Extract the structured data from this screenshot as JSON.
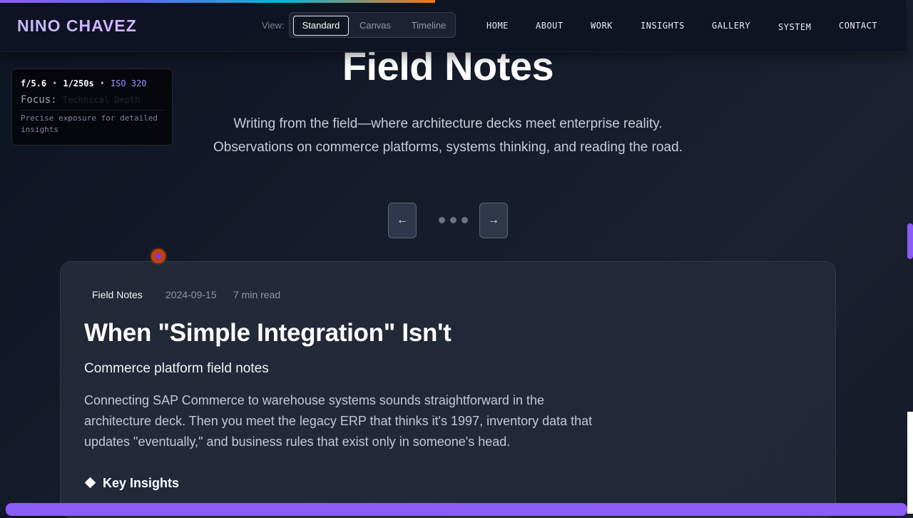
{
  "brand": {
    "logo": "NINO CHAVEZ"
  },
  "view": {
    "label": "View:",
    "options": [
      "Standard",
      "Canvas",
      "Timeline"
    ],
    "selected": "Standard"
  },
  "nav": {
    "items": [
      "HOME",
      "ABOUT",
      "WORK",
      "INSIGHTS",
      "GALLERY",
      "SYSTEM",
      "CONTACT"
    ]
  },
  "exposure": {
    "aperture": "f/5.6",
    "sep": "•",
    "shutter": "1/250s",
    "iso": "ISO 320",
    "focus_label": "Focus:",
    "focus_value": "Technical Depth",
    "description": "Precise exposure for detailed insights"
  },
  "hero": {
    "title": "Field Notes",
    "subtitle_line1": "Writing from the field—where architecture decks meet enterprise reality.",
    "subtitle_line2": "Observations on commerce platforms, systems thinking, and reading the road."
  },
  "carousel": {
    "prev_icon": "←",
    "next_icon": "→",
    "dot_count": 3
  },
  "article": {
    "category": "Field Notes",
    "date": "2024-09-15",
    "read_time": "7 min read",
    "title": "When \"Simple Integration\" Isn't",
    "subtitle": "Commerce platform field notes",
    "body": "Connecting SAP Commerce to warehouse systems sounds straightforward in the architecture deck. Then you meet the legacy ERP that thinks it's 1997, inventory data that updates \"eventually,\" and business rules that exist only in someone's head.",
    "insights_heading": "Key Insights"
  },
  "colors": {
    "accent": "#8b5cf6",
    "iso": "#a78bfa",
    "background": "#141b28"
  }
}
